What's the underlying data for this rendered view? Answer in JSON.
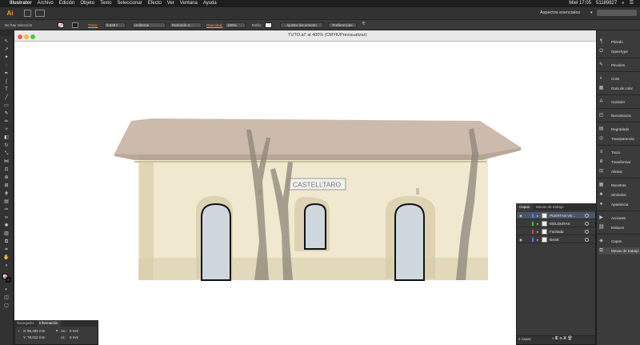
{
  "menubar": {
    "apple": "",
    "app": "Illustrator",
    "items": [
      "Archivo",
      "Edición",
      "Objeto",
      "Texto",
      "Seleccionar",
      "Efecto",
      "Ver",
      "Ventana",
      "Ayuda"
    ],
    "clock": "Miel 17:05",
    "user": "51189827"
  },
  "appbar": {
    "logo": "Ai",
    "workspace": "Aspectos esenciales"
  },
  "controlbar": {
    "selection": "No hay selección",
    "stroke_label": "Trazo:",
    "stroke_value": "0,528 t",
    "profile_value": "Uniforme",
    "brush_value": "Redondo 3...",
    "opacity_label": "Opacidad:",
    "opacity_value": "100%",
    "style_label": "Estilo:",
    "doc_setup_button": "Ajustar documento",
    "prefs_button": "Preferencias"
  },
  "document": {
    "title": "TUTO.ai* al 400% (CMYK/Previsualizar)",
    "sign_text": "CASTELLTARO",
    "colors": {
      "wall": "#ede5c7",
      "roof": "#c6b2a3",
      "door_fill": "#cfd7de",
      "door_stroke": "#111111",
      "tree": "#8c8478"
    }
  },
  "right_dock": {
    "items": [
      {
        "icon": "paragraph-icon",
        "label": "Párrafo"
      },
      {
        "icon": "opentype-icon",
        "label": "OpenType"
      },
      {
        "icon": "brushes-icon",
        "label": "Pinceles"
      },
      {
        "icon": "color-icon",
        "label": "Color"
      },
      {
        "icon": "color-guide-icon",
        "label": "Guía de color"
      },
      {
        "icon": "character-icon",
        "label": "Carácter"
      },
      {
        "icon": "pathfinder-icon",
        "label": "Buscatrazos"
      },
      {
        "icon": "gradient-icon",
        "label": "Degradado"
      },
      {
        "icon": "transparency-icon",
        "label": "Transparencia"
      },
      {
        "icon": "stroke-icon",
        "label": "Trazo"
      },
      {
        "icon": "transform-icon",
        "label": "Transformar"
      },
      {
        "icon": "align-icon",
        "label": "Alinear"
      },
      {
        "icon": "swatches-icon",
        "label": "Muestras"
      },
      {
        "icon": "symbols-icon",
        "label": "Símbolos"
      },
      {
        "icon": "appearance-icon",
        "label": "Apariencia"
      },
      {
        "icon": "actions-icon",
        "label": "Acciones"
      },
      {
        "icon": "links-icon",
        "label": "Enlaces"
      },
      {
        "icon": "layers-icon",
        "label": "Capas"
      },
      {
        "icon": "artboards-icon",
        "label": "Mesas de trabajo"
      }
    ]
  },
  "layers_panel": {
    "tabs": [
      "Capas",
      "Mesas de trabajo"
    ],
    "rows": [
      {
        "name": "PUERTAS-VE...",
        "color": "#4f7fff",
        "selected": true,
        "visible": true
      },
      {
        "name": "MOLDURAS",
        "color": "#3fbf3f",
        "selected": false,
        "visible": false
      },
      {
        "name": "Fachada",
        "color": "#d84a4a",
        "selected": false,
        "visible": false
      },
      {
        "name": "BASE",
        "color": "#4f7fff",
        "selected": false,
        "visible": true
      }
    ],
    "count": "4 capas"
  },
  "info_panel": {
    "tabs": [
      "Navegador",
      "Información"
    ],
    "x_label": "X:",
    "x_value": "96,485 mm",
    "y_label": "Y:",
    "y_value": "78,012 mm",
    "w_label": "An.:",
    "w_value": "0 mm",
    "h_label": "Al.:",
    "h_value": "0 mm"
  }
}
